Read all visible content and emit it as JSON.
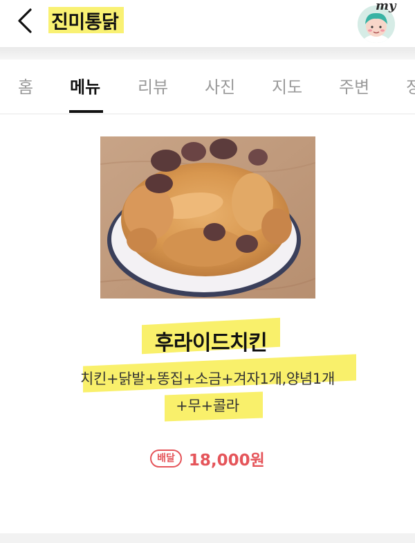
{
  "header": {
    "title": "진미통닭",
    "avatar_label": "my"
  },
  "tabs": [
    {
      "label": "홈",
      "active": false
    },
    {
      "label": "메뉴",
      "active": true
    },
    {
      "label": "리뷰",
      "active": false
    },
    {
      "label": "사진",
      "active": false
    },
    {
      "label": "지도",
      "active": false
    },
    {
      "label": "주변",
      "active": false
    },
    {
      "label": "정",
      "active": false
    }
  ],
  "menu": {
    "name": "후라이드치킨",
    "description_line1": "치킨+닭발+똥집+소금+겨자1개,양념1개",
    "description_line2": "+무+콜라",
    "badge": "배달",
    "price": "18,000원"
  },
  "colors": {
    "highlight": "#f9f06b",
    "price_red": "#e5555a",
    "active_tab": "#111111",
    "inactive_tab": "#9a9a9a"
  }
}
